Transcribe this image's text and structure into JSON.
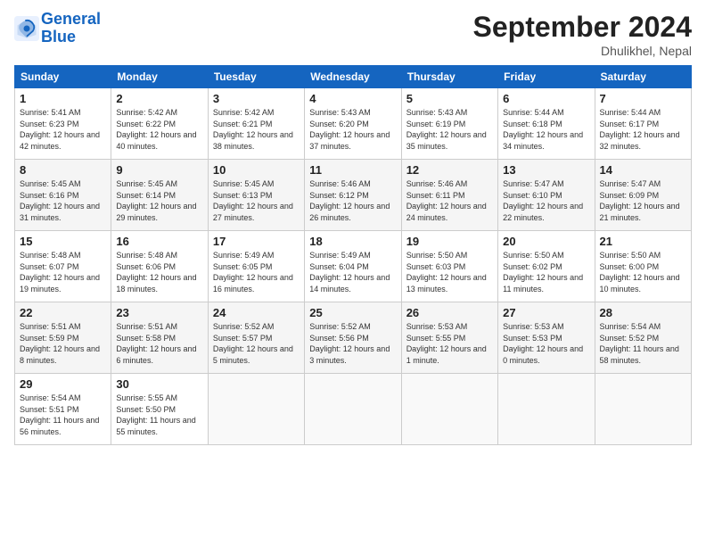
{
  "header": {
    "logo_line1": "General",
    "logo_line2": "Blue",
    "month_title": "September 2024",
    "subtitle": "Dhulikhel, Nepal"
  },
  "days_of_week": [
    "Sunday",
    "Monday",
    "Tuesday",
    "Wednesday",
    "Thursday",
    "Friday",
    "Saturday"
  ],
  "weeks": [
    [
      {
        "day": "1",
        "sunrise": "5:41 AM",
        "sunset": "6:23 PM",
        "daylight": "12 hours and 42 minutes."
      },
      {
        "day": "2",
        "sunrise": "5:42 AM",
        "sunset": "6:22 PM",
        "daylight": "12 hours and 40 minutes."
      },
      {
        "day": "3",
        "sunrise": "5:42 AM",
        "sunset": "6:21 PM",
        "daylight": "12 hours and 38 minutes."
      },
      {
        "day": "4",
        "sunrise": "5:43 AM",
        "sunset": "6:20 PM",
        "daylight": "12 hours and 37 minutes."
      },
      {
        "day": "5",
        "sunrise": "5:43 AM",
        "sunset": "6:19 PM",
        "daylight": "12 hours and 35 minutes."
      },
      {
        "day": "6",
        "sunrise": "5:44 AM",
        "sunset": "6:18 PM",
        "daylight": "12 hours and 34 minutes."
      },
      {
        "day": "7",
        "sunrise": "5:44 AM",
        "sunset": "6:17 PM",
        "daylight": "12 hours and 32 minutes."
      }
    ],
    [
      {
        "day": "8",
        "sunrise": "5:45 AM",
        "sunset": "6:16 PM",
        "daylight": "12 hours and 31 minutes."
      },
      {
        "day": "9",
        "sunrise": "5:45 AM",
        "sunset": "6:14 PM",
        "daylight": "12 hours and 29 minutes."
      },
      {
        "day": "10",
        "sunrise": "5:45 AM",
        "sunset": "6:13 PM",
        "daylight": "12 hours and 27 minutes."
      },
      {
        "day": "11",
        "sunrise": "5:46 AM",
        "sunset": "6:12 PM",
        "daylight": "12 hours and 26 minutes."
      },
      {
        "day": "12",
        "sunrise": "5:46 AM",
        "sunset": "6:11 PM",
        "daylight": "12 hours and 24 minutes."
      },
      {
        "day": "13",
        "sunrise": "5:47 AM",
        "sunset": "6:10 PM",
        "daylight": "12 hours and 22 minutes."
      },
      {
        "day": "14",
        "sunrise": "5:47 AM",
        "sunset": "6:09 PM",
        "daylight": "12 hours and 21 minutes."
      }
    ],
    [
      {
        "day": "15",
        "sunrise": "5:48 AM",
        "sunset": "6:07 PM",
        "daylight": "12 hours and 19 minutes."
      },
      {
        "day": "16",
        "sunrise": "5:48 AM",
        "sunset": "6:06 PM",
        "daylight": "12 hours and 18 minutes."
      },
      {
        "day": "17",
        "sunrise": "5:49 AM",
        "sunset": "6:05 PM",
        "daylight": "12 hours and 16 minutes."
      },
      {
        "day": "18",
        "sunrise": "5:49 AM",
        "sunset": "6:04 PM",
        "daylight": "12 hours and 14 minutes."
      },
      {
        "day": "19",
        "sunrise": "5:50 AM",
        "sunset": "6:03 PM",
        "daylight": "12 hours and 13 minutes."
      },
      {
        "day": "20",
        "sunrise": "5:50 AM",
        "sunset": "6:02 PM",
        "daylight": "12 hours and 11 minutes."
      },
      {
        "day": "21",
        "sunrise": "5:50 AM",
        "sunset": "6:00 PM",
        "daylight": "12 hours and 10 minutes."
      }
    ],
    [
      {
        "day": "22",
        "sunrise": "5:51 AM",
        "sunset": "5:59 PM",
        "daylight": "12 hours and 8 minutes."
      },
      {
        "day": "23",
        "sunrise": "5:51 AM",
        "sunset": "5:58 PM",
        "daylight": "12 hours and 6 minutes."
      },
      {
        "day": "24",
        "sunrise": "5:52 AM",
        "sunset": "5:57 PM",
        "daylight": "12 hours and 5 minutes."
      },
      {
        "day": "25",
        "sunrise": "5:52 AM",
        "sunset": "5:56 PM",
        "daylight": "12 hours and 3 minutes."
      },
      {
        "day": "26",
        "sunrise": "5:53 AM",
        "sunset": "5:55 PM",
        "daylight": "12 hours and 1 minute."
      },
      {
        "day": "27",
        "sunrise": "5:53 AM",
        "sunset": "5:53 PM",
        "daylight": "12 hours and 0 minutes."
      },
      {
        "day": "28",
        "sunrise": "5:54 AM",
        "sunset": "5:52 PM",
        "daylight": "11 hours and 58 minutes."
      }
    ],
    [
      {
        "day": "29",
        "sunrise": "5:54 AM",
        "sunset": "5:51 PM",
        "daylight": "11 hours and 56 minutes."
      },
      {
        "day": "30",
        "sunrise": "5:55 AM",
        "sunset": "5:50 PM",
        "daylight": "11 hours and 55 minutes."
      },
      null,
      null,
      null,
      null,
      null
    ]
  ]
}
